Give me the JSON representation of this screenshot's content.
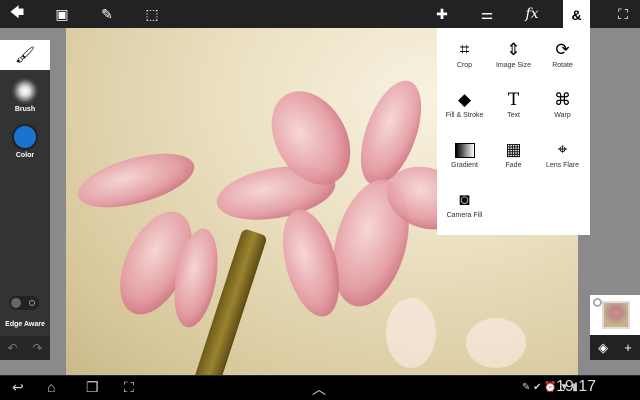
{
  "toolbar": {
    "back": "🡄",
    "add_image": "▣",
    "pencil": "✎",
    "selection": "⬚",
    "move": "✚",
    "adjust": "⚌",
    "fx": "fx",
    "more": "&",
    "fullscreen": "⛶"
  },
  "left_panel": {
    "brush_label": "Brush",
    "color_label": "Color",
    "color_value": "#1a73d0",
    "edge_aware_label": "Edge Aware",
    "undo": "↶",
    "redo": "↷"
  },
  "menu": {
    "items": [
      {
        "label": "Crop",
        "icon": "⌗"
      },
      {
        "label": "Image Size",
        "icon": "⇕"
      },
      {
        "label": "Rotate",
        "icon": "⟳"
      },
      {
        "label": "Fill & Stroke",
        "icon": "◆"
      },
      {
        "label": "Text",
        "icon": "T"
      },
      {
        "label": "Warp",
        "icon": "⌘"
      },
      {
        "label": "Gradient",
        "icon": "▭"
      },
      {
        "label": "Fade",
        "icon": "▦"
      },
      {
        "label": "Lens Flare",
        "icon": "⌖"
      },
      {
        "label": "Camera Fill",
        "icon": "◙"
      }
    ]
  },
  "right_panel": {
    "layers": "◈",
    "add": "+"
  },
  "navbar": {
    "back": "↩",
    "home": "⌂",
    "recent": "❐",
    "screenshot": "⛶",
    "up": "︿",
    "time": "19:17",
    "status": "✎ ✔ ⏰ ▼ ▮"
  }
}
